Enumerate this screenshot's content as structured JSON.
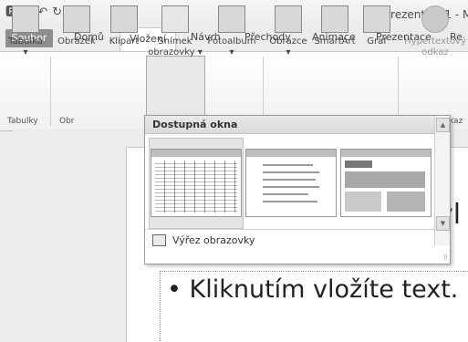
{
  "window": {
    "title": "Prezentace1 - M"
  },
  "qat": {
    "icons": [
      "ppt-app-icon",
      "save-icon",
      "undo-icon",
      "redo-icon",
      "customize-icon"
    ]
  },
  "tabs": [
    {
      "label": "Soubor"
    },
    {
      "label": "Domů"
    },
    {
      "label": "Vložení"
    },
    {
      "label": "Návrh"
    },
    {
      "label": "Přechody"
    },
    {
      "label": "Animace"
    },
    {
      "label": "Prezentace"
    },
    {
      "label": "Re"
    }
  ],
  "ribbon": {
    "buttons": [
      {
        "label": "Tabulka",
        "sub": "▾"
      },
      {
        "label": "Obrázek"
      },
      {
        "label": "Klipart"
      },
      {
        "label": "Snímek",
        "sub": "obrazovky ▾"
      },
      {
        "label": "Fotoalbum",
        "sub": "▾"
      },
      {
        "label": "Obrazce",
        "sub": "▾"
      },
      {
        "label": "SmartArt"
      },
      {
        "label": "Graf"
      },
      {
        "label": "Hypertextový",
        "sub": "odkaz"
      }
    ],
    "groups": [
      {
        "label": "Tabulky"
      },
      {
        "label": "Obr"
      },
      {
        "label": "kaz"
      }
    ]
  },
  "dropdown": {
    "header": "Dostupná okna",
    "footer": "Výřez obrazovky",
    "windows": [
      {
        "name": "excel-window"
      },
      {
        "name": "word-window"
      },
      {
        "name": "browser-window"
      }
    ]
  },
  "slide": {
    "title_fragment": "yl",
    "bullet": "• Kliknutím vložíte text."
  }
}
